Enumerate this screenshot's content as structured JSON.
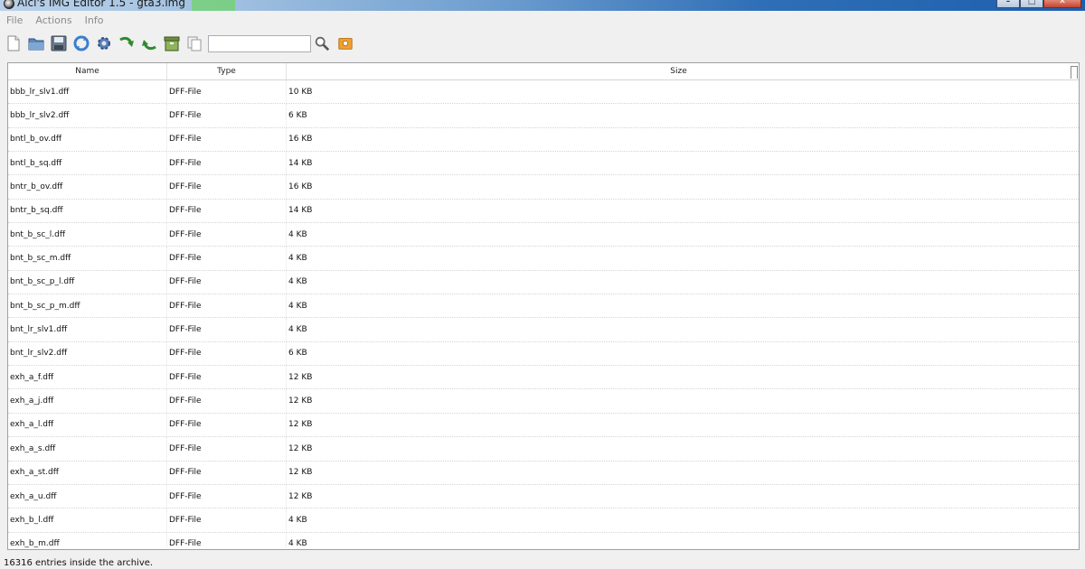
{
  "window": {
    "title": "Alci's IMG Editor 1.5 - gta3.img"
  },
  "menu": {
    "items": [
      "File",
      "Actions",
      "Info"
    ]
  },
  "toolbar": {
    "search_value": "",
    "icons": [
      "new-file-icon",
      "open-folder-icon",
      "save-icon",
      "refresh-icon",
      "settings-gear-icon",
      "import-arrow-icon",
      "export-arrow-icon",
      "archive-box-icon",
      "copy-icon",
      "search-icon",
      "open-folder-icon"
    ]
  },
  "table": {
    "columns": [
      "Name",
      "Type",
      "Size"
    ],
    "rows": [
      {
        "name": "bbb_lr_slv1.dff",
        "type": "DFF-File",
        "size": "10 KB"
      },
      {
        "name": "bbb_lr_slv2.dff",
        "type": "DFF-File",
        "size": "6 KB"
      },
      {
        "name": "bntl_b_ov.dff",
        "type": "DFF-File",
        "size": "16 KB"
      },
      {
        "name": "bntl_b_sq.dff",
        "type": "DFF-File",
        "size": "14 KB"
      },
      {
        "name": "bntr_b_ov.dff",
        "type": "DFF-File",
        "size": "16 KB"
      },
      {
        "name": "bntr_b_sq.dff",
        "type": "DFF-File",
        "size": "14 KB"
      },
      {
        "name": "bnt_b_sc_l.dff",
        "type": "DFF-File",
        "size": "4 KB"
      },
      {
        "name": "bnt_b_sc_m.dff",
        "type": "DFF-File",
        "size": "4 KB"
      },
      {
        "name": "bnt_b_sc_p_l.dff",
        "type": "DFF-File",
        "size": "4 KB"
      },
      {
        "name": "bnt_b_sc_p_m.dff",
        "type": "DFF-File",
        "size": "4 KB"
      },
      {
        "name": "bnt_lr_slv1.dff",
        "type": "DFF-File",
        "size": "4 KB"
      },
      {
        "name": "bnt_lr_slv2.dff",
        "type": "DFF-File",
        "size": "6 KB"
      },
      {
        "name": "exh_a_f.dff",
        "type": "DFF-File",
        "size": "12 KB"
      },
      {
        "name": "exh_a_j.dff",
        "type": "DFF-File",
        "size": "12 KB"
      },
      {
        "name": "exh_a_l.dff",
        "type": "DFF-File",
        "size": "12 KB"
      },
      {
        "name": "exh_a_s.dff",
        "type": "DFF-File",
        "size": "12 KB"
      },
      {
        "name": "exh_a_st.dff",
        "type": "DFF-File",
        "size": "12 KB"
      },
      {
        "name": "exh_a_u.dff",
        "type": "DFF-File",
        "size": "12 KB"
      },
      {
        "name": "exh_b_l.dff",
        "type": "DFF-File",
        "size": "4 KB"
      },
      {
        "name": "exh_b_m.dff",
        "type": "DFF-File",
        "size": "4 KB"
      }
    ]
  },
  "status": {
    "text": "16316 entries inside the archive."
  }
}
